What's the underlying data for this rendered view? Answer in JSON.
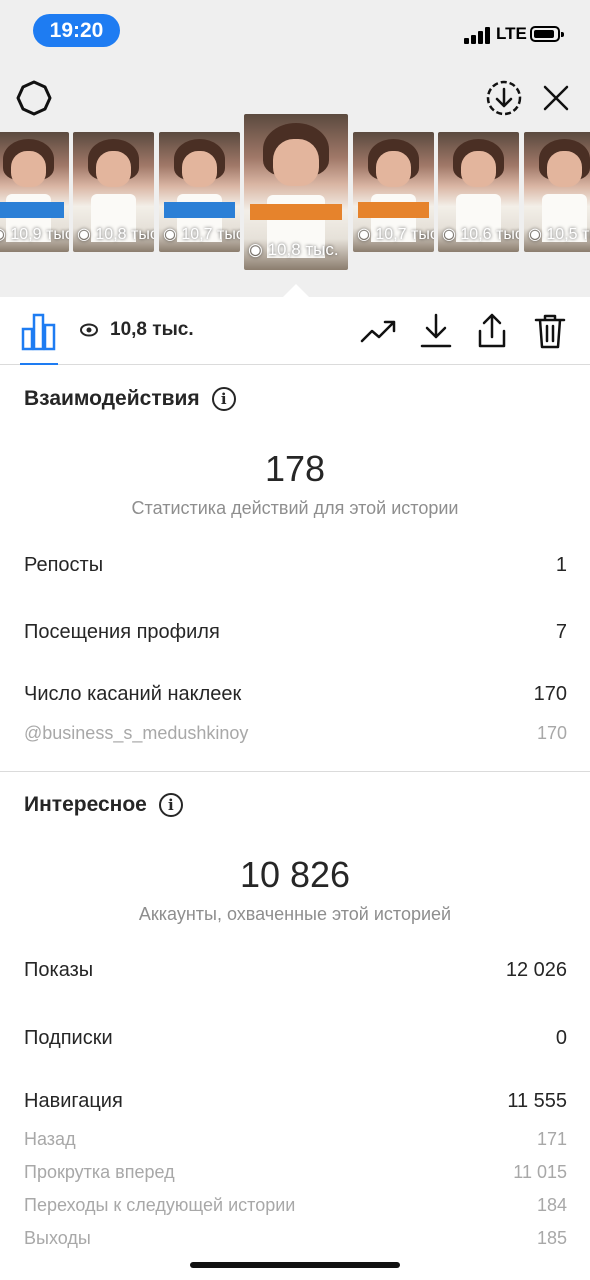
{
  "status_bar": {
    "time": "19:20",
    "network": "LTE"
  },
  "thumbnails": [
    {
      "views": "10,9 тыс"
    },
    {
      "views": "10,8 тыс"
    },
    {
      "views": "10,7 тыс"
    },
    {
      "views": "10,8 тыс.",
      "selected": true
    },
    {
      "views": "10,7 тыс"
    },
    {
      "views": "10,6 тыс"
    },
    {
      "views": "10,5 тыс"
    }
  ],
  "tools": {
    "views": "10,8 тыс."
  },
  "interactions": {
    "title": "Взаимодействия",
    "total": "178",
    "subtitle": "Статистика действий для этой истории",
    "rows": [
      {
        "label": "Репосты",
        "value": "1"
      },
      {
        "label": "Посещения профиля",
        "value": "7"
      },
      {
        "label": "Число касаний наклеек",
        "value": "170"
      }
    ],
    "sub_rows": [
      {
        "label": "@business_s_medushkinoy",
        "value": "170"
      }
    ]
  },
  "discovery": {
    "title": "Интересное",
    "total": "10 826",
    "subtitle": "Аккаунты, охваченные этой историей",
    "rows": [
      {
        "label": "Показы",
        "value": "12 026"
      },
      {
        "label": "Подписки",
        "value": "0"
      },
      {
        "label": "Навигация",
        "value": "11 555"
      }
    ],
    "sub_rows": [
      {
        "label": "Назад",
        "value": "171"
      },
      {
        "label": "Прокрутка вперед",
        "value": "11 015"
      },
      {
        "label": "Переходы к следующей истории",
        "value": "184"
      },
      {
        "label": "Выходы",
        "value": "185"
      }
    ]
  },
  "colors": {
    "accent": "#1e7cf2",
    "background_top": "#efefef",
    "text": "#262626",
    "secondary": "#8e8e8e"
  }
}
